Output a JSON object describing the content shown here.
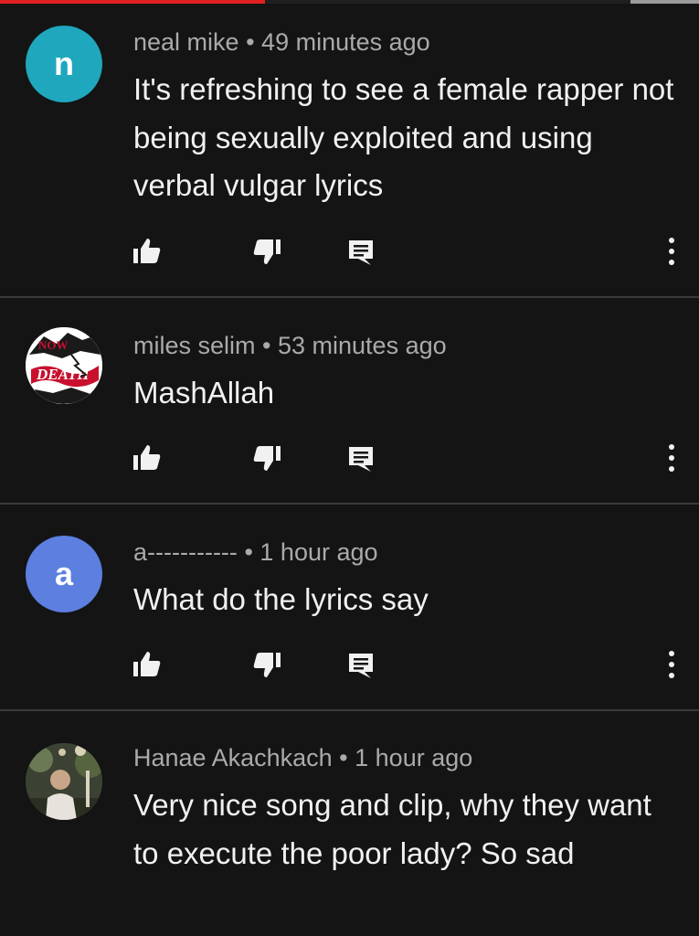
{
  "comments": [
    {
      "author": "neal mike",
      "time": "49 minutes ago",
      "text": "It's refreshing to see a female rapper not being sexually exploited and using verbal vulgar lyrics",
      "avatar_letter": "n",
      "avatar_color": "#1ea7bd"
    },
    {
      "author": "miles selim",
      "time": "53 minutes ago",
      "text": "MashAllah",
      "avatar_letter": "",
      "avatar_color": "#ffffff"
    },
    {
      "author": "a-----------",
      "time": "1 hour ago",
      "text": "What do the lyrics say",
      "avatar_letter": "a",
      "avatar_color": "#5c7fe0"
    },
    {
      "author": "Hanae Akachkach",
      "time": "1 hour ago",
      "text": "Very nice song and clip, why they want to execute the poor lady? So sad",
      "avatar_letter": "",
      "avatar_color": "#4a4f3e"
    }
  ],
  "separator": "•",
  "icons": {
    "like": "thumbs-up-icon",
    "dislike": "thumbs-down-icon",
    "reply": "comment-reply-icon",
    "more": "more-vertical-icon"
  }
}
